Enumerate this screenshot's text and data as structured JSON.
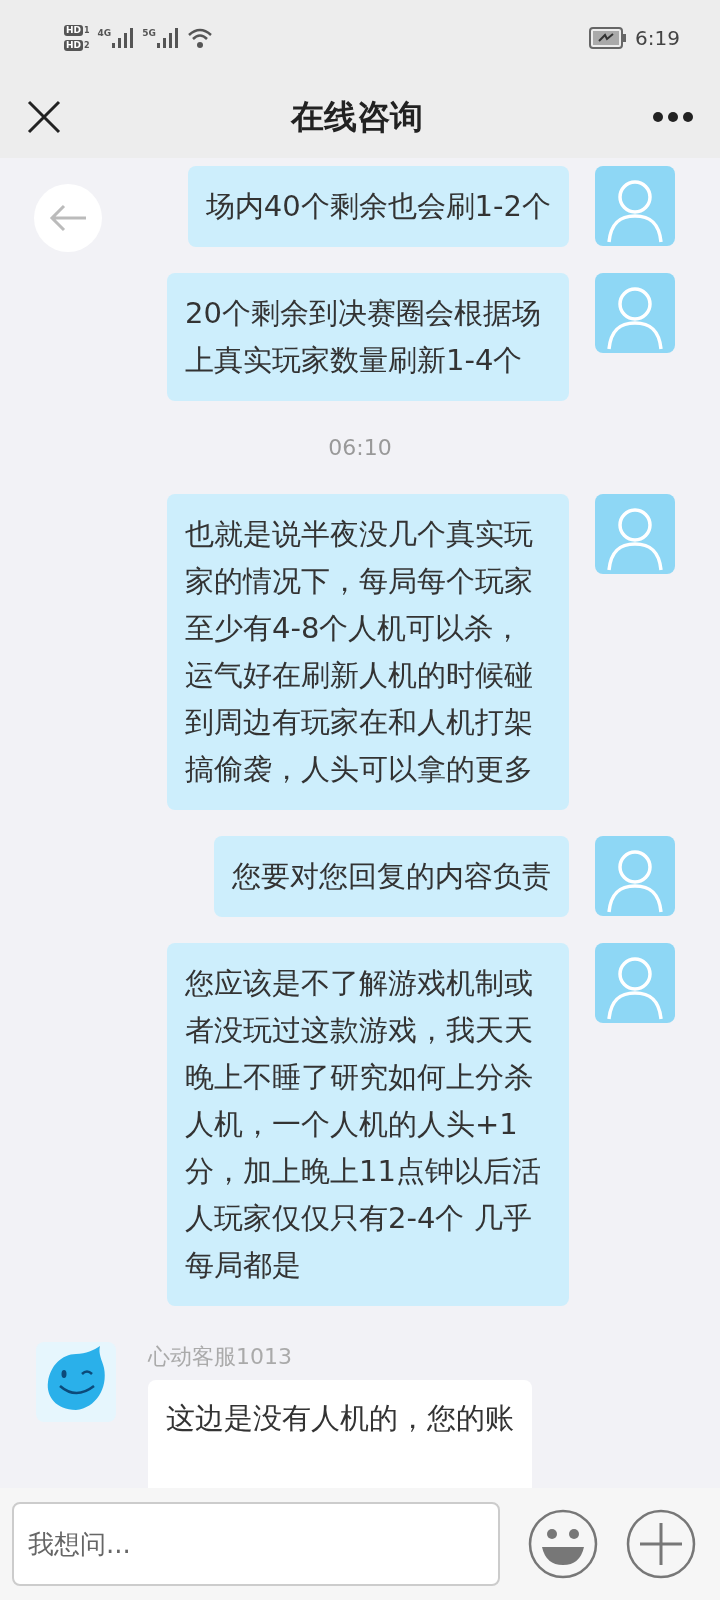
{
  "status_bar": {
    "sims": [
      {
        "label": "HD",
        "slot": "1"
      },
      {
        "label": "HD",
        "slot": "2"
      }
    ],
    "signals": [
      {
        "label": "4G"
      },
      {
        "label": "5G"
      }
    ],
    "time": "6:19"
  },
  "header": {
    "title": "在线咨询"
  },
  "messages": [
    {
      "kind": "outgoing",
      "text": "场内40个剩余也会刷1-2个"
    },
    {
      "kind": "outgoing",
      "text": "20个剩余到决赛圈会根据场上真实玩家数量刷新1-4个"
    },
    {
      "kind": "time",
      "text": "06:10"
    },
    {
      "kind": "outgoing",
      "text": "也就是说半夜没几个真实玩家的情况下，每局每个玩家至少有4-8个人机可以杀，运气好在刷新人机的时候碰到周边有玩家在和人机打架搞偷袭，人头可以拿的更多"
    },
    {
      "kind": "outgoing",
      "text": "您要对您回复的内容负责"
    },
    {
      "kind": "outgoing",
      "text": "您应该是不了解游戏机制或者没玩过这款游戏，我天天晚上不睡了研究如何上分杀人机，一个人机的人头+1分，加上晚上11点钟以后活人玩家仅仅只有2-4个 几乎每局都是"
    },
    {
      "kind": "incoming",
      "sender": "心动客服1013",
      "text": "这边是没有人机的，您的账"
    }
  ],
  "input": {
    "placeholder": "我想问..."
  }
}
